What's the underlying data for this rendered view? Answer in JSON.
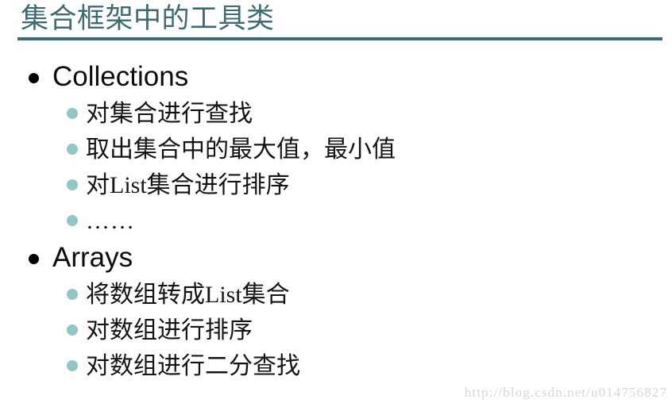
{
  "slide": {
    "title": "集合框架中的工具类",
    "sections": [
      {
        "heading": "Collections",
        "items": [
          "对集合进行查找",
          "取出集合中的最大值，最小值",
          "对List集合进行排序",
          "……"
        ]
      },
      {
        "heading": "Arrays",
        "items": [
          "将数组转成List集合",
          "对数组进行排序",
          "对数组进行二分查找"
        ]
      }
    ]
  },
  "watermark": "http://blog.csdn.net/u014756827",
  "colors": {
    "title": "#3f6a71",
    "rule": "#3d6a70",
    "level1_bullet": "#000000",
    "level2_bullet": "#93c7c7",
    "body_text": "#141414",
    "watermark": "#d7d7d7",
    "background": "#ffffff"
  }
}
